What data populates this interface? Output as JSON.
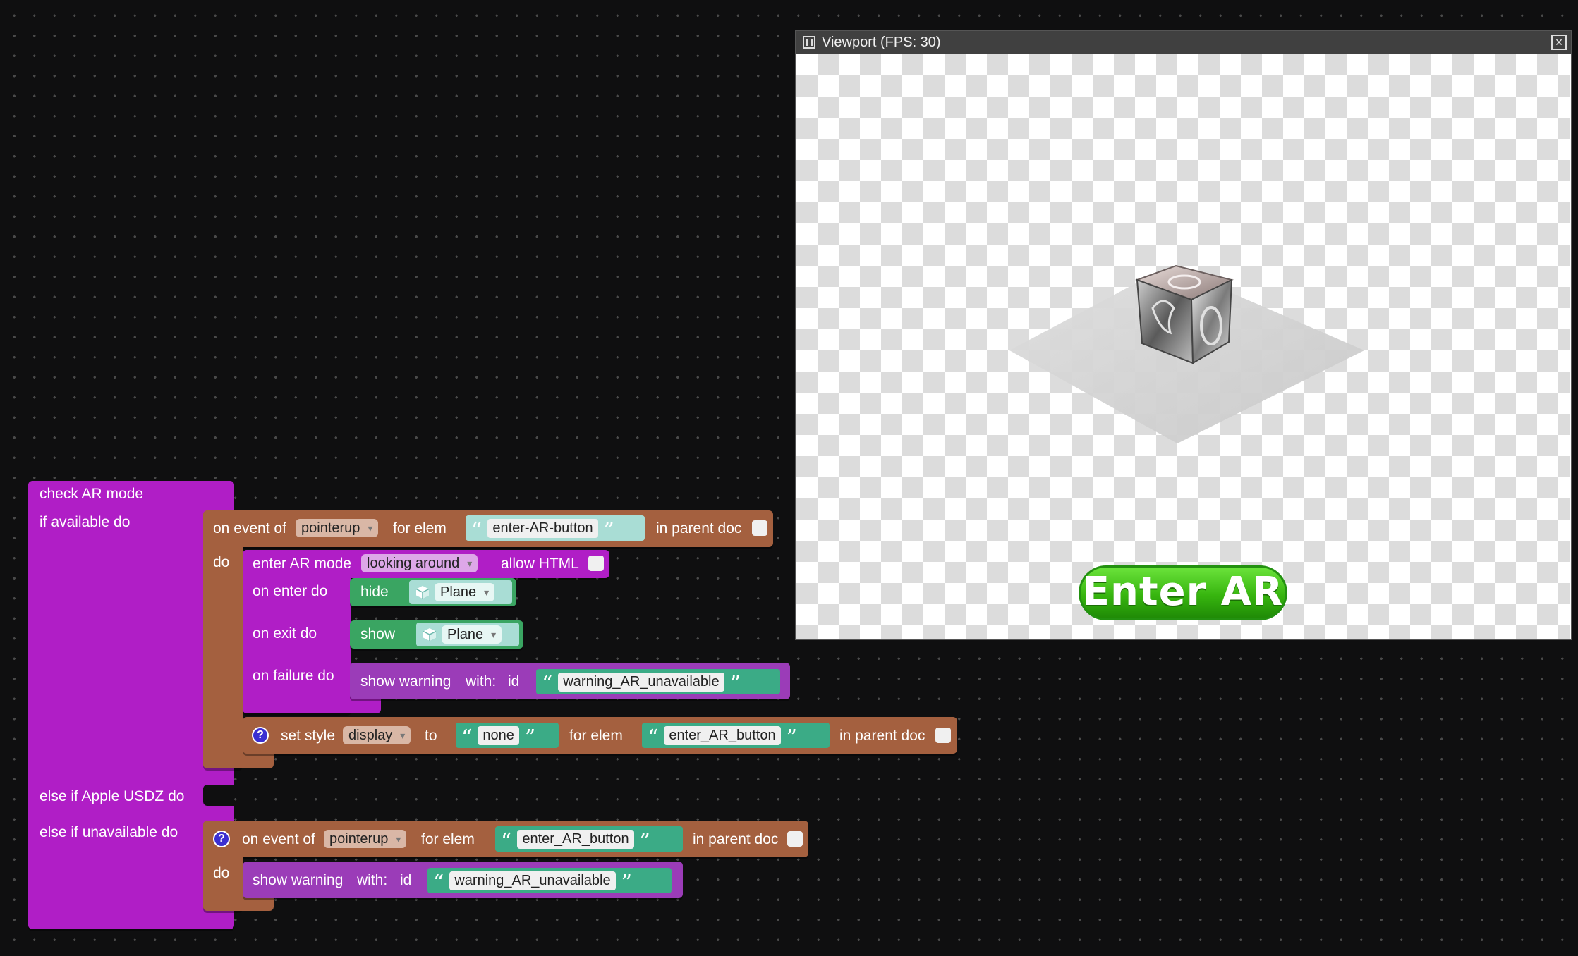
{
  "viewport": {
    "title": "Viewport (FPS: 30)",
    "close_icon": "×",
    "enter_ar_label": "Enter AR"
  },
  "blocks": {
    "check_ar": {
      "title": "check AR mode",
      "if_available": "if available do",
      "else_if_usdz": "else if Apple USDZ do",
      "else_if_unavailable": "else if unavailable do"
    },
    "event1": {
      "on_event_of": "on event of",
      "event": "pointerup",
      "for_elem": "for elem",
      "elem": "enter-AR-button",
      "in_parent_doc": "in parent doc",
      "do": "do"
    },
    "enter_ar": {
      "label": "enter AR mode",
      "mode": "looking around",
      "allow_html": "allow HTML",
      "on_enter": "on enter do",
      "on_exit": "on exit do",
      "on_failure": "on failure do"
    },
    "hide": {
      "label": "hide",
      "object": "Plane"
    },
    "show": {
      "label": "show",
      "object": "Plane"
    },
    "warning1": {
      "label": "show warning",
      "with": "with:",
      "id": "id",
      "value": "warning_AR_unavailable"
    },
    "set_style": {
      "label": "set style",
      "property": "display",
      "to": "to",
      "value": "none",
      "for_elem": "for elem",
      "elem": "enter_AR_button",
      "in_parent_doc": "in parent doc"
    },
    "event2": {
      "on_event_of": "on event of",
      "event": "pointerup",
      "for_elem": "for elem",
      "elem": "enter_AR_button",
      "in_parent_doc": "in parent doc",
      "do": "do"
    },
    "warning2": {
      "label": "show warning",
      "with": "with:",
      "id": "id",
      "value": "warning_AR_unavailable"
    }
  },
  "colors": {
    "purple": "#b01ec6",
    "brown": "#a4603f",
    "green": "#3aa562",
    "teal": "#3bab86",
    "enter_ar_green": "#37b50f"
  }
}
